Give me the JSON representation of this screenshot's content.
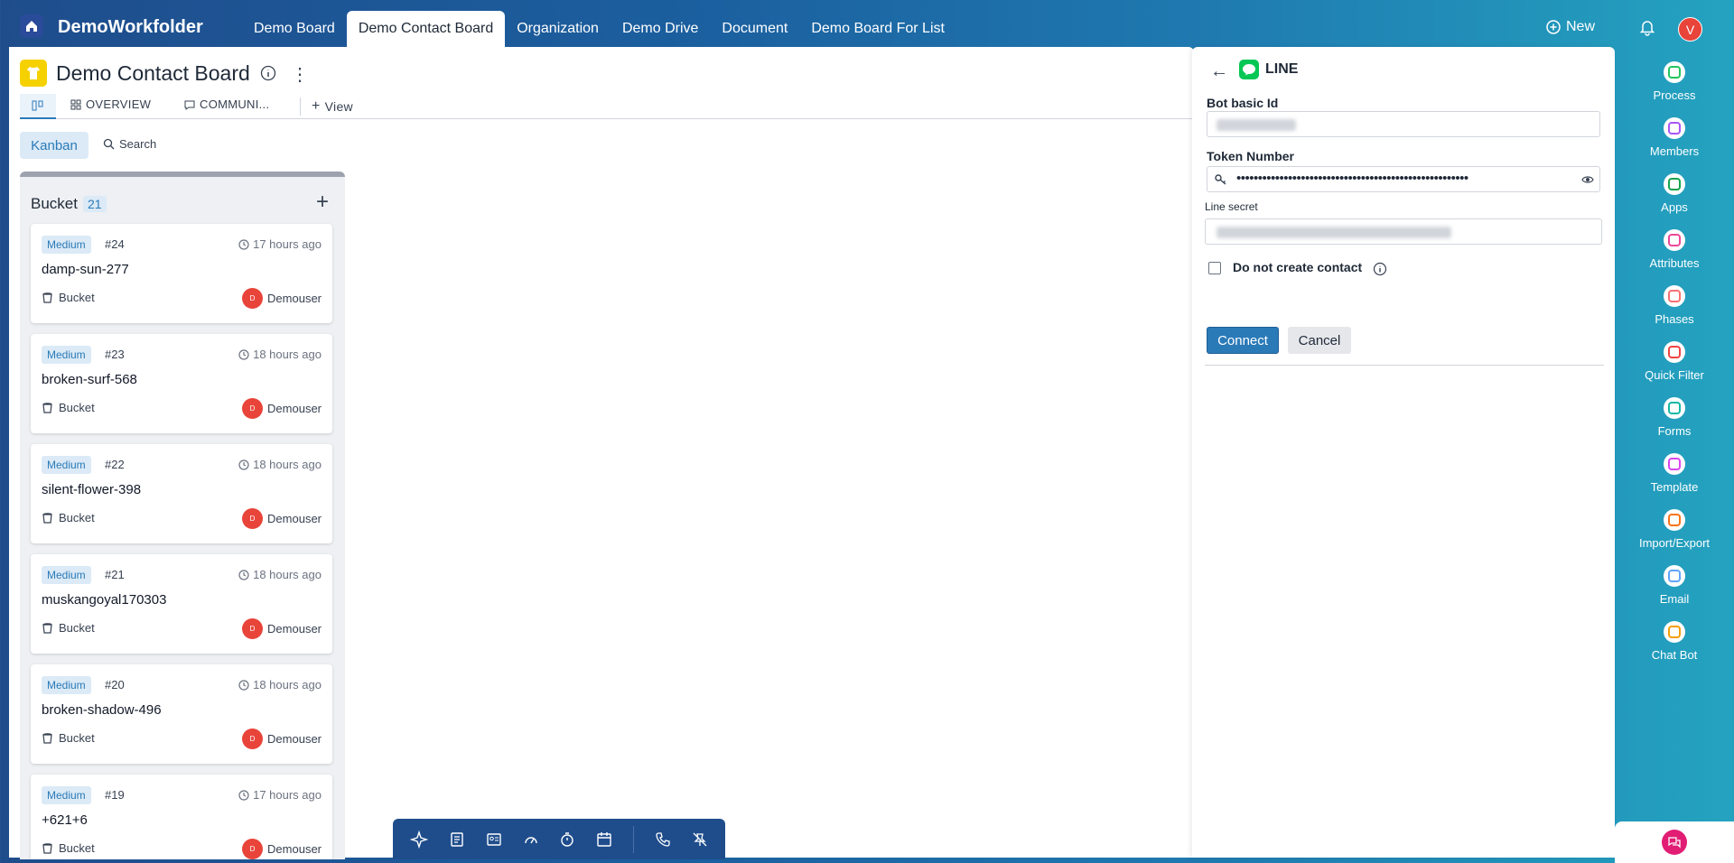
{
  "app": {
    "name": "DemoWorkfolder"
  },
  "nav": {
    "tabs": [
      {
        "label": "Demo Board"
      },
      {
        "label": "Demo Contact Board"
      },
      {
        "label": "Organization"
      },
      {
        "label": "Demo Drive"
      },
      {
        "label": "Document"
      },
      {
        "label": "Demo Board For List"
      }
    ],
    "active_tab": "Demo Contact Board",
    "new_label": "New",
    "user_initial": "V"
  },
  "board": {
    "title": "Demo Contact Board",
    "view_tabs": [
      {
        "label": "OVERVIEW"
      },
      {
        "label": "COMMUNI..."
      }
    ],
    "add_view_label": "View",
    "kanban_label": "Kanban",
    "search_label": "Search"
  },
  "column": {
    "title": "Bucket",
    "count": "21",
    "cards": [
      {
        "priority": "Medium",
        "number": "#24",
        "time": "17 hours ago",
        "name": "damp-sun-277",
        "bucket": "Bucket",
        "user": "Demouser",
        "initial": "D"
      },
      {
        "priority": "Medium",
        "number": "#23",
        "time": "18 hours ago",
        "name": "broken-surf-568",
        "bucket": "Bucket",
        "user": "Demouser",
        "initial": "D"
      },
      {
        "priority": "Medium",
        "number": "#22",
        "time": "18 hours ago",
        "name": "silent-flower-398",
        "bucket": "Bucket",
        "user": "Demouser",
        "initial": "D"
      },
      {
        "priority": "Medium",
        "number": "#21",
        "time": "18 hours ago",
        "name": "muskangoyal170303",
        "bucket": "Bucket",
        "user": "Demouser",
        "initial": "D"
      },
      {
        "priority": "Medium",
        "number": "#20",
        "time": "18 hours ago",
        "name": "broken-shadow-496",
        "bucket": "Bucket",
        "user": "Demouser",
        "initial": "D"
      },
      {
        "priority": "Medium",
        "number": "#19",
        "time": "17 hours ago",
        "name": "+621+6",
        "bucket": "Bucket",
        "user": "Demouser",
        "initial": "D"
      }
    ]
  },
  "panel": {
    "title": "LINE",
    "bot_id_label": "Bot basic Id",
    "token_label": "Token Number",
    "token_value": "••••••••••••••••••••••••••••••••••••••••••••••••••••••",
    "secret_label": "Line secret",
    "no_contact_label": "Do not create contact",
    "connect_label": "Connect",
    "cancel_label": "Cancel"
  },
  "right_sidebar": {
    "items": [
      {
        "label": "Process",
        "color": "#22c55e",
        "icon": "process-icon"
      },
      {
        "label": "Members",
        "color": "#a855f7",
        "icon": "members-icon"
      },
      {
        "label": "Apps",
        "color": "#16a34a",
        "icon": "apps-icon"
      },
      {
        "label": "Attributes",
        "color": "#ec4899",
        "icon": "attributes-icon"
      },
      {
        "label": "Phases",
        "color": "#f87171",
        "icon": "phases-icon"
      },
      {
        "label": "Quick Filter",
        "color": "#ef4444",
        "icon": "filter-icon"
      },
      {
        "label": "Forms",
        "color": "#14b8a6",
        "icon": "forms-icon"
      },
      {
        "label": "Template",
        "color": "#d946ef",
        "icon": "template-icon"
      },
      {
        "label": "Import/Export",
        "color": "#f97316",
        "icon": "import-export-icon"
      },
      {
        "label": "Email",
        "color": "#60a5fa",
        "icon": "email-icon"
      },
      {
        "label": "Chat Bot",
        "color": "#f59e0b",
        "icon": "chat-bot-icon"
      }
    ]
  },
  "colors": {
    "accent": "#2a7ab8",
    "nav_bg": "#1f4d8c",
    "avatar": "#e8443a",
    "line_green": "#06c755"
  }
}
